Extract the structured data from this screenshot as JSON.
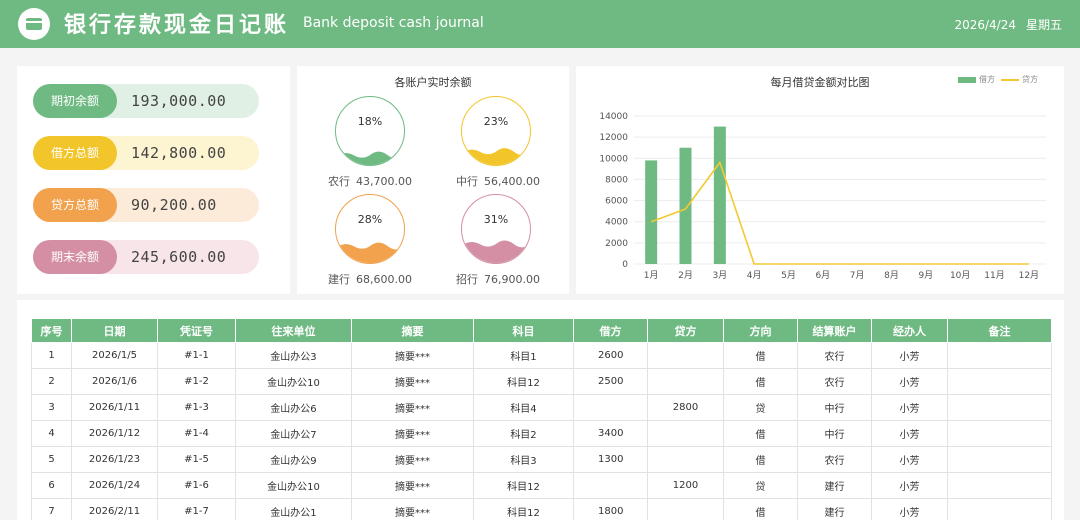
{
  "header": {
    "title_cn": "银行存款现金日记账",
    "title_en": "Bank deposit cash journal",
    "date": "2026/4/24",
    "weekday": "星期五",
    "logo_icon": "bank-card-icon"
  },
  "colors": {
    "green": "#6fba83",
    "yellow": "#f2c933",
    "orange": "#f2a14d",
    "pink": "#d48fa5"
  },
  "summary": [
    {
      "label": "期初余额",
      "value": "193,000.00",
      "color": "#6fba83",
      "bg": "#e1f0e5"
    },
    {
      "label": "借方总额",
      "value": "142,800.00",
      "color": "#f2c62b",
      "bg": "#fdf4d2"
    },
    {
      "label": "贷方总额",
      "value": "90,200.00",
      "color": "#f2a14d",
      "bg": "#fdebda"
    },
    {
      "label": "期末余额",
      "value": "245,600.00",
      "color": "#d48fa5",
      "bg": "#f7e5ea"
    }
  ],
  "accounts": {
    "title": "各账户实时余额",
    "items": [
      {
        "name": "农行",
        "pct": "18%",
        "fill": 0.18,
        "amount": "43,700.00",
        "color": "#6fba83"
      },
      {
        "name": "中行",
        "pct": "23%",
        "fill": 0.23,
        "amount": "56,400.00",
        "color": "#f2c62b"
      },
      {
        "name": "建行",
        "pct": "28%",
        "fill": 0.28,
        "amount": "68,600.00",
        "color": "#f2a14d"
      },
      {
        "name": "招行",
        "pct": "31%",
        "fill": 0.31,
        "amount": "76,900.00",
        "color": "#d48fa5"
      }
    ]
  },
  "chart": {
    "title": "每月借贷金额对比图",
    "legend_bar": "借方",
    "legend_line": "贷方"
  },
  "chart_data": {
    "type": "bar",
    "title": "每月借贷金额对比图",
    "categories": [
      "1月",
      "2月",
      "3月",
      "4月",
      "5月",
      "6月",
      "7月",
      "8月",
      "9月",
      "10月",
      "11月",
      "12月"
    ],
    "series": [
      {
        "name": "借方",
        "type": "bar",
        "color": "#6fba83",
        "values": [
          9800,
          11000,
          13000,
          0,
          0,
          0,
          0,
          0,
          0,
          0,
          0,
          0
        ]
      },
      {
        "name": "贷方",
        "type": "line",
        "color": "#f2c933",
        "values": [
          4000,
          5200,
          9600,
          0,
          0,
          0,
          0,
          0,
          0,
          0,
          0,
          0
        ]
      }
    ],
    "ylim": [
      0,
      14000
    ],
    "yticks": [
      0,
      2000,
      4000,
      6000,
      8000,
      10000,
      12000,
      14000
    ],
    "grid": true,
    "legend": "top-right"
  },
  "table": {
    "headers": [
      "序号",
      "日期",
      "凭证号",
      "往来单位",
      "摘要",
      "科目",
      "借方",
      "贷方",
      "方向",
      "结算账户",
      "经办人",
      "备注"
    ],
    "rows": [
      [
        "1",
        "2026/1/5",
        "#1-1",
        "金山办公3",
        "摘要***",
        "科目1",
        "2600",
        "",
        "借",
        "农行",
        "小芳",
        ""
      ],
      [
        "2",
        "2026/1/6",
        "#1-2",
        "金山办公10",
        "摘要***",
        "科目12",
        "2500",
        "",
        "借",
        "农行",
        "小芳",
        ""
      ],
      [
        "3",
        "2026/1/11",
        "#1-3",
        "金山办公6",
        "摘要***",
        "科目4",
        "",
        "2800",
        "贷",
        "中行",
        "小芳",
        ""
      ],
      [
        "4",
        "2026/1/12",
        "#1-4",
        "金山办公7",
        "摘要***",
        "科目2",
        "3400",
        "",
        "借",
        "中行",
        "小芳",
        ""
      ],
      [
        "5",
        "2026/1/23",
        "#1-5",
        "金山办公9",
        "摘要***",
        "科目3",
        "1300",
        "",
        "借",
        "农行",
        "小芳",
        ""
      ],
      [
        "6",
        "2026/1/24",
        "#1-6",
        "金山办公10",
        "摘要***",
        "科目12",
        "",
        "1200",
        "贷",
        "建行",
        "小芳",
        ""
      ],
      [
        "7",
        "2026/2/11",
        "#1-7",
        "金山办公1",
        "摘要***",
        "科目12",
        "1800",
        "",
        "借",
        "建行",
        "小芳",
        ""
      ]
    ]
  }
}
